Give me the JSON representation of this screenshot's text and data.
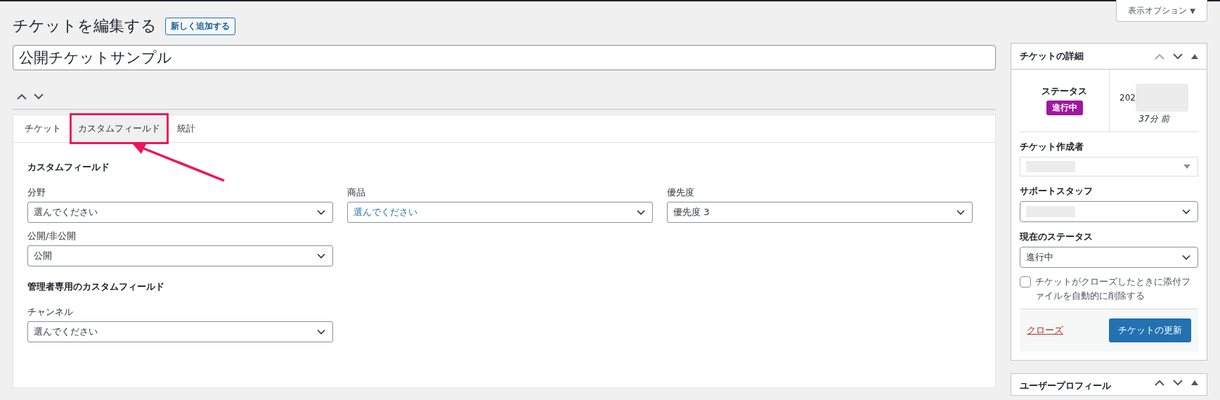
{
  "screen_options": {
    "label": "表示オプション",
    "caret": "▼"
  },
  "page_title": "チケットを編集する",
  "add_new_button": "新しく追加する",
  "ticket_title": {
    "value": "公開チケットサンプル"
  },
  "tabs": [
    {
      "label": "チケット",
      "selected": false
    },
    {
      "label": "カスタムフィールド",
      "selected": true
    },
    {
      "label": "統計",
      "selected": false
    }
  ],
  "sections": [
    {
      "heading": "カスタムフィールド",
      "fields": [
        {
          "label": "分野",
          "value": "選んでください",
          "focused": false
        },
        {
          "label": "商品",
          "value": "選んでください",
          "focused": true
        },
        {
          "label": "優先度",
          "value": "優先度 3",
          "focused": false
        },
        {
          "label": "公開/非公開",
          "value": "公開",
          "focused": false
        }
      ]
    },
    {
      "heading": "管理者専用のカスタムフィールド",
      "fields": [
        {
          "label": "チャンネル",
          "value": "選んでください",
          "focused": false
        }
      ]
    }
  ],
  "sidebar": {
    "details": {
      "title": "チケットの詳細",
      "status_label": "ステータス",
      "status_badge": "進行中",
      "date": "202",
      "ago": "37分 前",
      "author_label": "チケット作成者",
      "staff_label": "サポートスタッフ",
      "current_status_label": "現在のステータス",
      "current_status_value": "進行中",
      "delete_attachments": {
        "label": "チケットがクローズしたときに添付ファイルを自動的に削除する",
        "checked": false
      },
      "close_link": "クローズ",
      "update_button": "チケットの更新"
    },
    "profile": {
      "title": "ユーザープロフィール"
    }
  }
}
